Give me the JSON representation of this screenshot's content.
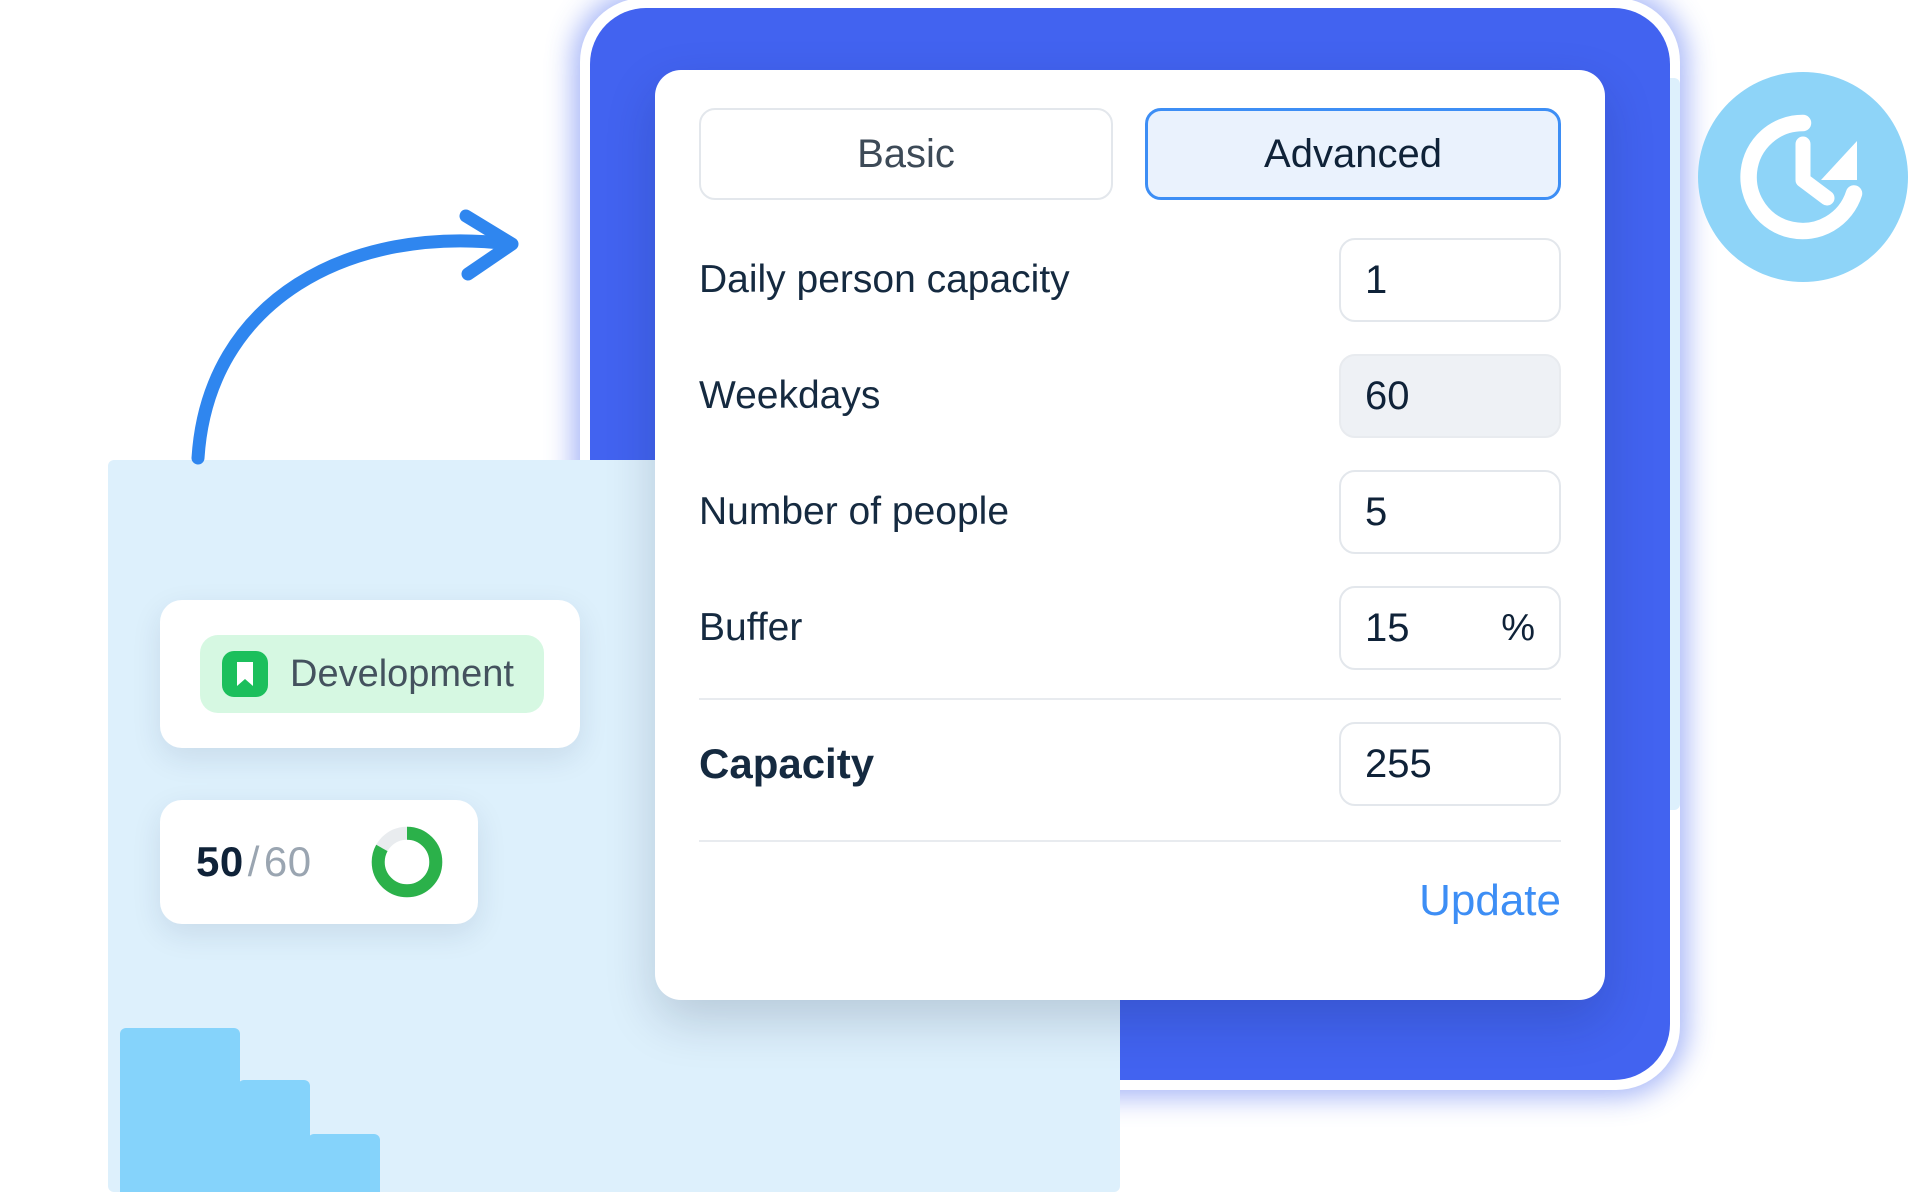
{
  "decor": {
    "clock_icon": "clock-refresh-icon",
    "arrow_icon": "curved-arrow-icon",
    "stairs_icon": "descending-bars-icon"
  },
  "tag_card": {
    "icon": "bookmark-icon",
    "label": "Development",
    "pill_color": "#d6f8e2",
    "icon_color": "#1cbf5c"
  },
  "progress_card": {
    "current": "50",
    "separator": "/",
    "total": "60",
    "percent": 83,
    "ring_color": "#2bb14a",
    "track_color": "#e9ecef"
  },
  "settings": {
    "tabs": [
      {
        "label": "Basic",
        "active": false
      },
      {
        "label": "Advanced",
        "active": true
      }
    ],
    "rows": [
      {
        "label": "Daily person capacity",
        "value": "1",
        "unit": "",
        "filled": false
      },
      {
        "label": "Weekdays",
        "value": "60",
        "unit": "",
        "filled": true
      },
      {
        "label": "Number of people",
        "value": "5",
        "unit": "",
        "filled": false
      },
      {
        "label": "Buffer",
        "value": "15",
        "unit": "%",
        "filled": false
      }
    ],
    "total": {
      "label": "Capacity",
      "value": "255"
    },
    "update_label": "Update",
    "accent_color": "#3d8ef5"
  }
}
